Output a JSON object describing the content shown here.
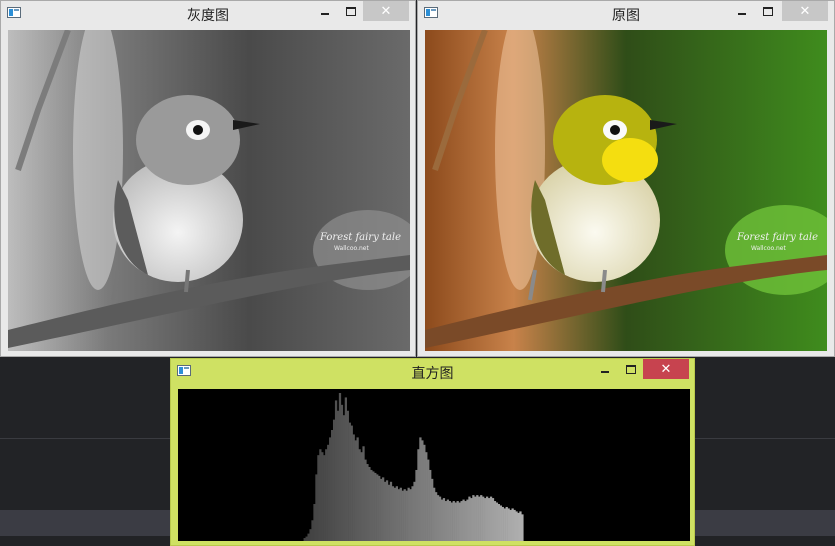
{
  "windows": {
    "gray": {
      "title": "灰度图"
    },
    "original": {
      "title": "原图"
    },
    "histogram": {
      "title": "直方图"
    }
  },
  "watermark": {
    "line1": "Forest fairy tale",
    "line2": "Wallcoo.net"
  },
  "controls": {
    "close_glyph": "✕"
  },
  "colors": {
    "histogram_frame": "#cfe163",
    "close_red": "#c7434f",
    "close_gray": "#c7c7c7"
  },
  "chart_data": {
    "type": "bar",
    "title": "",
    "bins": 256,
    "note_values": "relative bin heights 0-1 read from histogram, index = gray level",
    "values": [
      0,
      0,
      0,
      0,
      0,
      0,
      0,
      0,
      0,
      0,
      0,
      0,
      0,
      0,
      0,
      0,
      0,
      0,
      0,
      0,
      0,
      0,
      0,
      0,
      0,
      0,
      0,
      0,
      0,
      0,
      0,
      0,
      0,
      0,
      0,
      0,
      0,
      0,
      0,
      0,
      0,
      0,
      0,
      0,
      0,
      0,
      0,
      0,
      0,
      0,
      0,
      0,
      0,
      0,
      0,
      0,
      0,
      0,
      0,
      0,
      0,
      0,
      0,
      0,
      0.02,
      0.03,
      0.05,
      0.08,
      0.14,
      0.25,
      0.45,
      0.58,
      0.62,
      0.6,
      0.58,
      0.62,
      0.65,
      0.7,
      0.75,
      0.82,
      0.95,
      0.88,
      1.0,
      0.92,
      0.85,
      0.97,
      0.88,
      0.8,
      0.78,
      0.72,
      0.68,
      0.7,
      0.62,
      0.6,
      0.64,
      0.55,
      0.52,
      0.5,
      0.48,
      0.47,
      0.46,
      0.45,
      0.44,
      0.42,
      0.43,
      0.4,
      0.41,
      0.38,
      0.4,
      0.37,
      0.36,
      0.37,
      0.35,
      0.36,
      0.34,
      0.35,
      0.34,
      0.36,
      0.35,
      0.37,
      0.4,
      0.48,
      0.62,
      0.7,
      0.68,
      0.65,
      0.6,
      0.55,
      0.48,
      0.42,
      0.36,
      0.33,
      0.31,
      0.3,
      0.28,
      0.29,
      0.27,
      0.28,
      0.27,
      0.26,
      0.27,
      0.26,
      0.27,
      0.26,
      0.27,
      0.28,
      0.27,
      0.28,
      0.3,
      0.29,
      0.31,
      0.3,
      0.31,
      0.3,
      0.31,
      0.3,
      0.29,
      0.3,
      0.29,
      0.3,
      0.29,
      0.27,
      0.26,
      0.25,
      0.24,
      0.23,
      0.22,
      0.23,
      0.22,
      0.21,
      0.22,
      0.21,
      0.2,
      0.19,
      0.2,
      0.18,
      0,
      0,
      0,
      0,
      0,
      0,
      0,
      0,
      0,
      0,
      0,
      0,
      0,
      0,
      0,
      0,
      0,
      0,
      0,
      0,
      0,
      0,
      0,
      0,
      0,
      0,
      0,
      0,
      0,
      0,
      0,
      0,
      0,
      0,
      0,
      0,
      0,
      0,
      0,
      0,
      0,
      0,
      0,
      0,
      0,
      0,
      0,
      0,
      0,
      0,
      0,
      0,
      0,
      0,
      0,
      0,
      0,
      0,
      0,
      0,
      0,
      0,
      0,
      0,
      0,
      0,
      0,
      0,
      0,
      0,
      0,
      0,
      0,
      0,
      0,
      0,
      0,
      0,
      0,
      0,
      0,
      0,
      0,
      0,
      0
    ]
  }
}
